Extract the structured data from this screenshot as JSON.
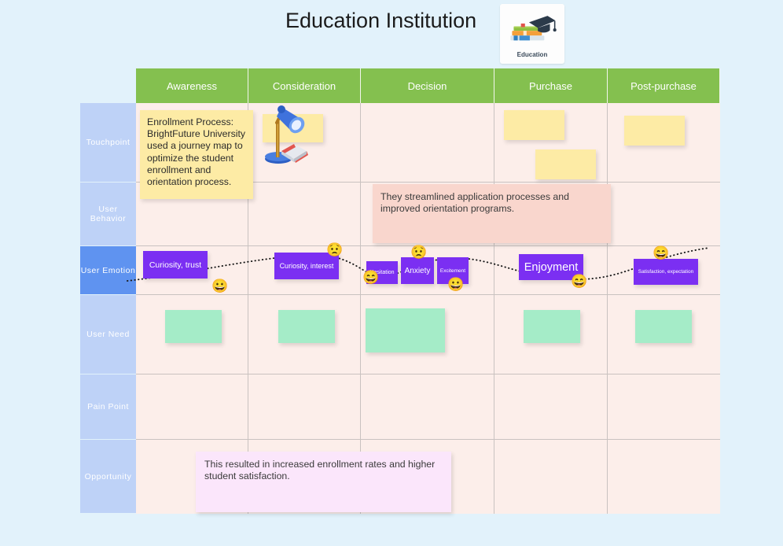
{
  "header": {
    "title": "Education Institution",
    "logo_caption": "Education",
    "logo_icon": "graduation-cap-books-icon"
  },
  "colors": {
    "page_background": "#e2f2fb",
    "column_header": "#84c04f",
    "row_label": "#bed2f7",
    "row_label_active": "#5f93f0",
    "cell_background": "#fceeea",
    "sticky_yellow": "#fdeba5",
    "sticky_green": "#a5ecc8",
    "sticky_purple": "#7b2ff2",
    "sticky_pink": "#f9d6cd",
    "sticky_lavender": "#fbe6fb"
  },
  "stages": [
    {
      "label": "Awareness"
    },
    {
      "label": "Consideration"
    },
    {
      "label": "Decision"
    },
    {
      "label": "Purchase"
    },
    {
      "label": "Post-purchase"
    }
  ],
  "rows": [
    {
      "label": "Touchpoint",
      "active": false
    },
    {
      "label": "User  Behavior",
      "active": false
    },
    {
      "label": "User  Emotion",
      "active": true
    },
    {
      "label": "User  Need",
      "active": false
    },
    {
      "label": "Pain  Point",
      "active": false
    },
    {
      "label": "Opportunity",
      "active": false
    }
  ],
  "notes": {
    "touchpoint_awareness": "Enrollment Process: BrightFuture University used a journey map to optimize the student enrollment and orientation process.",
    "user_behavior_decision": "They streamlined application processes and improved orientation programs.",
    "opportunity_awareness": "This resulted in increased enrollment rates and higher student satisfaction."
  },
  "emotions": [
    {
      "label": "Curiosity, trust",
      "stage": "Awareness"
    },
    {
      "label": "Curiosity, interest",
      "stage": "Consideration"
    },
    {
      "label": "Hesitation",
      "stage": "Decision"
    },
    {
      "label": "Anxiety",
      "stage": "Decision"
    },
    {
      "label": "Excitement",
      "stage": "Decision"
    },
    {
      "label": "Enjoyment",
      "stage": "Purchase"
    },
    {
      "label": "Satisfaction, expectation",
      "stage": "Post-purchase"
    }
  ],
  "emojis": {
    "grinning": "😀",
    "worried": "😟",
    "grinning_squint": "😄"
  },
  "empty_notes": {
    "touchpoint_consideration": "",
    "touchpoint_purchase_1": "",
    "touchpoint_purchase_2": "",
    "touchpoint_postpurchase": "",
    "need_awareness": "",
    "need_consideration": "",
    "need_decision": "",
    "need_purchase": "",
    "need_postpurchase": ""
  }
}
